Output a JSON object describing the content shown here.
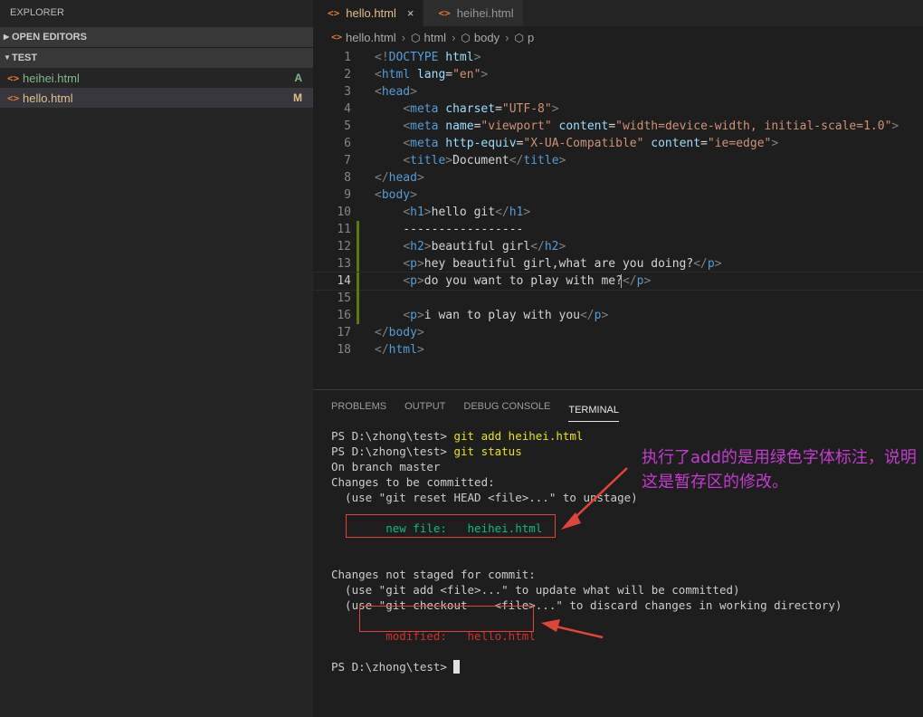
{
  "sidebar": {
    "title": "EXPLORER",
    "sections": {
      "open_editors": "OPEN EDITORS",
      "folder": "TEST"
    },
    "files": [
      {
        "icon": "<>",
        "name": "heihei.html",
        "badge": "A"
      },
      {
        "icon": "<>",
        "name": "hello.html",
        "badge": "M"
      }
    ]
  },
  "tabs": [
    {
      "name": "hello.html",
      "close": "×"
    },
    {
      "name": "heihei.html"
    }
  ],
  "breadcrumb": {
    "file": "hello.html",
    "items": [
      "html",
      "body",
      "p"
    ],
    "sep": "›"
  },
  "code_lines": [
    {
      "n": "1",
      "tokens": [
        [
          "br",
          "<!"
        ],
        [
          "tag",
          "DOCTYPE"
        ],
        [
          "tx",
          " "
        ],
        [
          "at",
          "html"
        ],
        [
          "br",
          ">"
        ]
      ]
    },
    {
      "n": "2",
      "tokens": [
        [
          "br",
          "<"
        ],
        [
          "tag",
          "html"
        ],
        [
          "tx",
          " "
        ],
        [
          "at",
          "lang"
        ],
        [
          "tx",
          "="
        ],
        [
          "val",
          "\"en\""
        ],
        [
          "br",
          ">"
        ]
      ]
    },
    {
      "n": "3",
      "tokens": [
        [
          "br",
          "<"
        ],
        [
          "tag",
          "head"
        ],
        [
          "br",
          ">"
        ]
      ]
    },
    {
      "n": "4",
      "tokens": [
        [
          "tx",
          "    "
        ],
        [
          "br",
          "<"
        ],
        [
          "tag",
          "meta"
        ],
        [
          "tx",
          " "
        ],
        [
          "at",
          "charset"
        ],
        [
          "tx",
          "="
        ],
        [
          "val",
          "\"UTF-8\""
        ],
        [
          "br",
          ">"
        ]
      ]
    },
    {
      "n": "5",
      "tokens": [
        [
          "tx",
          "    "
        ],
        [
          "br",
          "<"
        ],
        [
          "tag",
          "meta"
        ],
        [
          "tx",
          " "
        ],
        [
          "at",
          "name"
        ],
        [
          "tx",
          "="
        ],
        [
          "val",
          "\"viewport\""
        ],
        [
          "tx",
          " "
        ],
        [
          "at",
          "content"
        ],
        [
          "tx",
          "="
        ],
        [
          "val",
          "\"width=device-width, initial-scale=1.0\""
        ],
        [
          "br",
          ">"
        ]
      ]
    },
    {
      "n": "6",
      "tokens": [
        [
          "tx",
          "    "
        ],
        [
          "br",
          "<"
        ],
        [
          "tag",
          "meta"
        ],
        [
          "tx",
          " "
        ],
        [
          "at",
          "http-equiv"
        ],
        [
          "tx",
          "="
        ],
        [
          "val",
          "\"X-UA-Compatible\""
        ],
        [
          "tx",
          " "
        ],
        [
          "at",
          "content"
        ],
        [
          "tx",
          "="
        ],
        [
          "val",
          "\"ie=edge\""
        ],
        [
          "br",
          ">"
        ]
      ]
    },
    {
      "n": "7",
      "tokens": [
        [
          "tx",
          "    "
        ],
        [
          "br",
          "<"
        ],
        [
          "tag",
          "title"
        ],
        [
          "br",
          ">"
        ],
        [
          "tx",
          "Document"
        ],
        [
          "br",
          "</"
        ],
        [
          "tag",
          "title"
        ],
        [
          "br",
          ">"
        ]
      ]
    },
    {
      "n": "8",
      "tokens": [
        [
          "br",
          "</"
        ],
        [
          "tag",
          "head"
        ],
        [
          "br",
          ">"
        ]
      ]
    },
    {
      "n": "9",
      "tokens": [
        [
          "br",
          "<"
        ],
        [
          "tag",
          "body"
        ],
        [
          "br",
          ">"
        ]
      ]
    },
    {
      "n": "10",
      "tokens": [
        [
          "tx",
          "    "
        ],
        [
          "br",
          "<"
        ],
        [
          "tag",
          "h1"
        ],
        [
          "br",
          ">"
        ],
        [
          "tx",
          "hello git"
        ],
        [
          "br",
          "</"
        ],
        [
          "tag",
          "h1"
        ],
        [
          "br",
          ">"
        ]
      ]
    },
    {
      "n": "11",
      "mod": true,
      "tokens": [
        [
          "tx",
          "    -----------------"
        ]
      ]
    },
    {
      "n": "12",
      "mod": true,
      "tokens": [
        [
          "tx",
          "    "
        ],
        [
          "br",
          "<"
        ],
        [
          "tag",
          "h2"
        ],
        [
          "br",
          ">"
        ],
        [
          "tx",
          "beautiful girl"
        ],
        [
          "br",
          "</"
        ],
        [
          "tag",
          "h2"
        ],
        [
          "br",
          ">"
        ]
      ]
    },
    {
      "n": "13",
      "mod": true,
      "tokens": [
        [
          "tx",
          "    "
        ],
        [
          "br",
          "<"
        ],
        [
          "tag",
          "p"
        ],
        [
          "br",
          ">"
        ],
        [
          "tx",
          "hey beautiful girl,what are you doing?"
        ],
        [
          "br",
          "</"
        ],
        [
          "tag",
          "p"
        ],
        [
          "br",
          ">"
        ]
      ]
    },
    {
      "n": "14",
      "mod": true,
      "current": true,
      "tokens": [
        [
          "tx",
          "    "
        ],
        [
          "br",
          "<"
        ],
        [
          "tag",
          "p"
        ],
        [
          "br",
          ">"
        ],
        [
          "tx",
          "do you want to play with me?"
        ],
        [
          "br",
          "</"
        ],
        [
          "tag",
          "p"
        ],
        [
          "br",
          ">"
        ]
      ]
    },
    {
      "n": "15",
      "mod": true,
      "tokens": [
        [
          "tx",
          ""
        ]
      ]
    },
    {
      "n": "16",
      "mod": true,
      "tokens": [
        [
          "tx",
          "    "
        ],
        [
          "br",
          "<"
        ],
        [
          "tag",
          "p"
        ],
        [
          "br",
          ">"
        ],
        [
          "tx",
          "i wan to play with you"
        ],
        [
          "br",
          "</"
        ],
        [
          "tag",
          "p"
        ],
        [
          "br",
          ">"
        ]
      ]
    },
    {
      "n": "17",
      "tokens": [
        [
          "br",
          "</"
        ],
        [
          "tag",
          "body"
        ],
        [
          "br",
          ">"
        ]
      ]
    },
    {
      "n": "18",
      "tokens": [
        [
          "br",
          "</"
        ],
        [
          "tag",
          "html"
        ],
        [
          "br",
          ">"
        ]
      ]
    }
  ],
  "panel": {
    "tabs": [
      "PROBLEMS",
      "OUTPUT",
      "DEBUG CONSOLE",
      "TERMINAL"
    ],
    "terminal": {
      "l1_prompt": "PS D:\\zhong\\test> ",
      "l1_cmd": "git add heihei.html",
      "l2_prompt": "PS D:\\zhong\\test> ",
      "l2_cmd": "git status",
      "l3": "On branch master",
      "l4": "Changes to be committed:",
      "l5": "  (use \"git reset HEAD <file>...\" to unstage)",
      "l7": "        new file:   heihei.html",
      "l9": "Changes not staged for commit:",
      "l10": "  (use \"git add <file>...\" to update what will be committed)",
      "l11": "  (use \"git checkout -- <file>...\" to discard changes in working directory)",
      "l13": "        modified:   hello.html",
      "l15_prompt": "PS D:\\zhong\\test> "
    }
  },
  "annotation": {
    "text": "执行了add的是用绿色字体标注，说明这是暂存区的修改。",
    "color": "#c43bd0"
  },
  "colors": {
    "accent_green": "#0dbc79",
    "error_red": "#cd3131",
    "box_red": "#e0453b",
    "git_added": "#81b88b",
    "git_modified": "#e2c08d"
  }
}
